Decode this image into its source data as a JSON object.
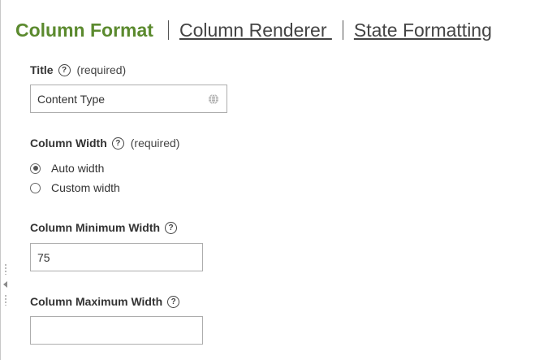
{
  "tabs": [
    {
      "label": "Column Format",
      "active": true
    },
    {
      "label": "Column Renderer ",
      "active": false
    },
    {
      "label": "State Formatting",
      "active": false
    }
  ],
  "title_field": {
    "label": "Title",
    "help": "?",
    "required": "(required)",
    "value": "Content Type",
    "icon": "globe-icon"
  },
  "column_width": {
    "label": "Column Width",
    "help": "?",
    "required": "(required)",
    "options": [
      {
        "label": "Auto width",
        "checked": true
      },
      {
        "label": "Custom width",
        "checked": false
      }
    ]
  },
  "min_width": {
    "label": "Column Minimum Width",
    "help": "?",
    "value": "75"
  },
  "max_width": {
    "label": "Column Maximum Width",
    "help": "?",
    "value": ""
  },
  "colors": {
    "active_tab": "#5b8a2e",
    "border": "#adadad"
  }
}
